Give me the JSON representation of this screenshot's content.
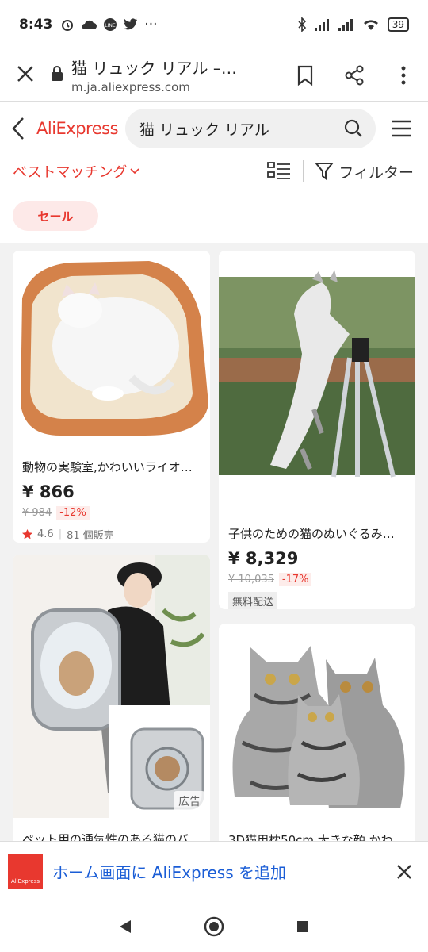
{
  "status_bar": {
    "time": "8:43",
    "battery": "39",
    "app_icons": [
      "alarm-icon",
      "cloud-icon",
      "line-icon",
      "twitter-icon",
      "more-icon"
    ]
  },
  "browser": {
    "page_title": "猫 リュック リアル –…",
    "url": "m.ja.aliexpress.com"
  },
  "header": {
    "logo": "AliExpress",
    "search_query": "猫 リュック リアル"
  },
  "toolbar": {
    "sort_label": "ベストマッチング",
    "filter_label": "フィルター"
  },
  "chip": {
    "label": "セール"
  },
  "products": [
    {
      "title": "動物の実験室,かわいいライオ…",
      "price": "¥ 866",
      "original": "¥ 984",
      "discount": "-12%",
      "rating": "4.6",
      "sold": "81 個販売"
    },
    {
      "title": "子供のための猫のぬいぐるみバ…",
      "price": "¥ 8,329",
      "original": "¥ 10,035",
      "discount": "-17%",
      "tag": "無料配送"
    },
    {
      "title": "ペット用の通気性のある猫のバ…",
      "ad_label": "広告"
    },
    {
      "title": "3D猫用枕50cm,大きな顔,かわ…"
    }
  ],
  "install_banner": {
    "text": "ホーム画面に AliExpress を追加",
    "logo_text": "AliExpress"
  },
  "colors": {
    "accent": "#e8382f",
    "link": "#1a5dd6"
  }
}
